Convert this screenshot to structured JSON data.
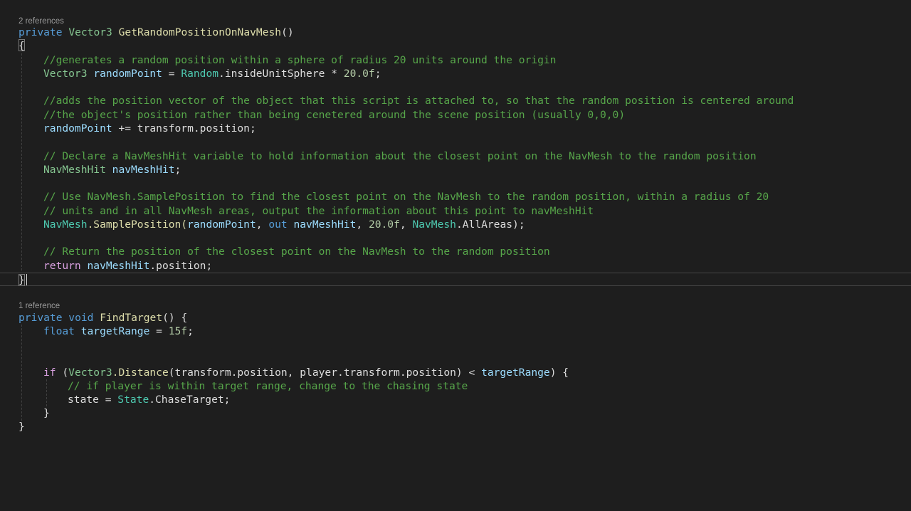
{
  "code_lens": {
    "method1_refs": "2 references",
    "method2_refs": "1 reference"
  },
  "code": {
    "l1_access": "private",
    "l1_type": "Vector3",
    "l1_name": "GetRandomPositionOnNavMesh",
    "l1_parens": "()",
    "l2": "{",
    "l3_comment": "//generates a random position within a sphere of radius 20 units around the origin",
    "l4_type": "Vector3",
    "l4_var": "randomPoint",
    "l4_eq": " = ",
    "l4_cls": "Random",
    "l4_prop": ".insideUnitSphere * ",
    "l4_num": "20.0f",
    "l4_end": ";",
    "l6_comment": "//adds the position vector of the object that this script is attached to, so that the random position is centered around",
    "l7_comment": "//the object's position rather than being cenetered around the scene position (usually 0,0,0)",
    "l8_var": "randomPoint",
    "l8_rest": " += transform.position;",
    "l10_comment": "// Declare a NavMeshHit variable to hold information about the closest point on the NavMesh to the random position",
    "l11_type": "NavMeshHit",
    "l11_var": "navMeshHit",
    "l11_end": ";",
    "l13_comment": "// Use NavMesh.SamplePosition to find the closest point on the NavMesh to the random position, within a radius of 20",
    "l14_comment": "// units and in all NavMesh areas, output the information about this point to navMeshHit",
    "l15_cls": "NavMesh",
    "l15_fn": ".SamplePosition(",
    "l15_var1": "randomPoint",
    "l15_sep1": ", ",
    "l15_out": "out",
    "l15_var2": " navMeshHit",
    "l15_sep2": ", ",
    "l15_num": "20.0f",
    "l15_sep3": ", ",
    "l15_cls2": "NavMesh",
    "l15_rest": ".AllAreas);",
    "l17_comment": "// Return the position of the closest point on the NavMesh to the random position",
    "l18_kw": "return",
    "l18_var": " navMeshHit",
    "l18_rest": ".position;",
    "l19": "}",
    "l22_access": "private",
    "l22_void": " void",
    "l22_name": " FindTarget",
    "l22_rest": "() {",
    "l23_kw": "float",
    "l23_var": " targetRange",
    "l23_eq": " = ",
    "l23_num": "15f",
    "l23_end": ";",
    "l26_kw": "if",
    "l26_a": " (",
    "l26_cls": "Vector3",
    "l26_fn": ".Distance",
    "l26_b": "(transform.position, player.transform.position) < ",
    "l26_var": "targetRange",
    "l26_c": ") {",
    "l27_comment": "// if player is within target range, change to the chasing state",
    "l28_a": "state = ",
    "l28_cls": "State",
    "l28_b": ".ChaseTarget;",
    "l29": "}",
    "l30": "}"
  }
}
